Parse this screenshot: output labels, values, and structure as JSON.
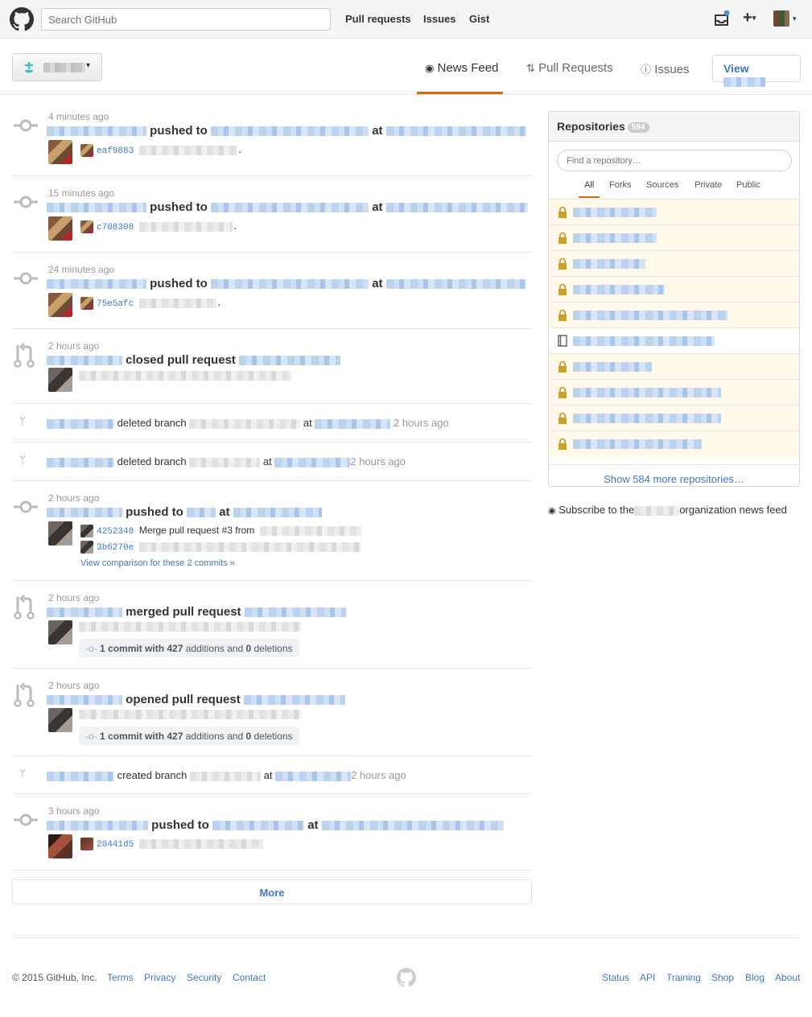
{
  "header": {
    "search_placeholder": "Search GitHub",
    "nav": [
      "Pull requests",
      "Issues",
      "Gist"
    ]
  },
  "subnav": {
    "tabs": [
      "News Feed",
      "Pull Requests",
      "Issues"
    ],
    "view_label": "View"
  },
  "feed": [
    {
      "time": "4 minutes ago",
      "action": "pushed to",
      "at": "at",
      "commits": [
        {
          "sha": "eaf9883"
        }
      ]
    },
    {
      "time": "15 minutes ago",
      "action": "pushed to",
      "at": "at",
      "commits": [
        {
          "sha": "c708308"
        }
      ]
    },
    {
      "time": "24 minutes ago",
      "action": "pushed to",
      "at": "at",
      "commits": [
        {
          "sha": "75e5afc"
        }
      ]
    },
    {
      "time": "2 hours ago",
      "action": "closed pull request"
    },
    {
      "action": "deleted branch",
      "at": "at",
      "time": "2 hours ago"
    },
    {
      "action": "deleted branch",
      "at": "at",
      "time": "2 hours ago"
    },
    {
      "time": "2 hours ago",
      "action": "pushed to",
      "at": "at",
      "commits": [
        {
          "sha": "4252348",
          "msg": "Merge pull request #3 from"
        },
        {
          "sha": "3b6270e"
        }
      ],
      "compare": "View comparison for these 2 commits »"
    },
    {
      "time": "2 hours ago",
      "action": "merged pull request",
      "stat": {
        "pre": "1 commit with ",
        "additions": "427",
        "mid": " additions and ",
        "deletions": "0",
        "post": " deletions"
      }
    },
    {
      "time": "2 hours ago",
      "action": "opened pull request",
      "stat": {
        "pre": "1 commit with ",
        "additions": "427",
        "mid": " additions and ",
        "deletions": "0",
        "post": " deletions"
      }
    },
    {
      "action": "created branch",
      "at": "at",
      "time": "2 hours ago"
    },
    {
      "time": "3 hours ago",
      "action": "pushed to",
      "at": "at",
      "commits": [
        {
          "sha": "20441d5"
        }
      ]
    }
  ],
  "more_label": "More",
  "repos": {
    "title": "Repositories",
    "count": "594",
    "filter_placeholder": "Find a repository…",
    "tabs": [
      "All",
      "Forks",
      "Sources",
      "Private",
      "Public"
    ],
    "show_more": "Show 584 more repositories…"
  },
  "subscribe": {
    "pre": "Subscribe to the",
    "post": "organization news feed"
  },
  "footer": {
    "copyright": "© 2015 GitHub, Inc.",
    "left_links": [
      "Terms",
      "Privacy",
      "Security",
      "Contact"
    ],
    "right_links": [
      "Status",
      "API",
      "Training",
      "Shop",
      "Blog",
      "About"
    ]
  },
  "colors": {
    "accent": "#d26911",
    "link": "#4078c0",
    "private_row": "#fff9ea"
  }
}
